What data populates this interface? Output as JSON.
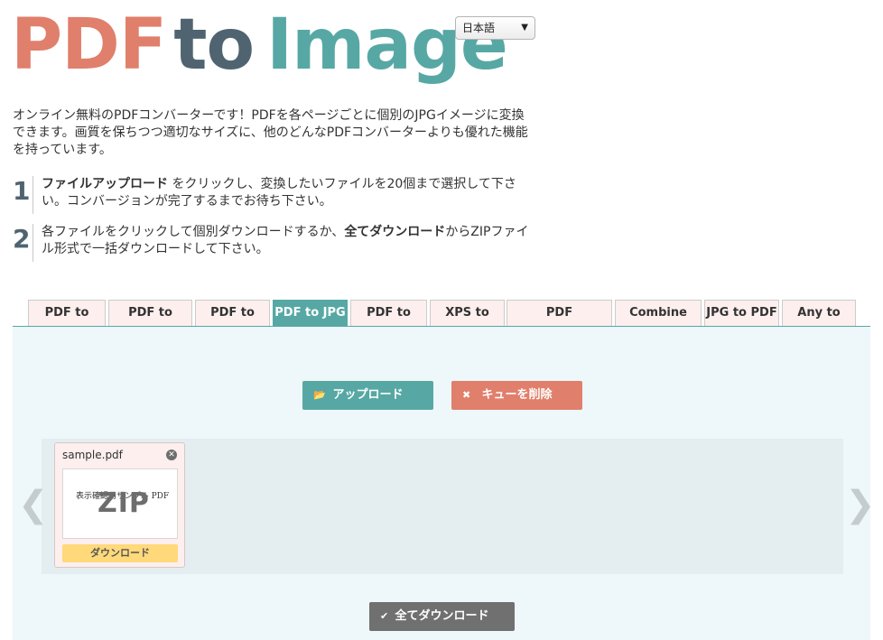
{
  "logo": {
    "part1": "PDF",
    "part2": "to",
    "part3": "Image"
  },
  "language": {
    "selected": "日本語"
  },
  "intro": "オンライン無料のPDFコンバーターです！PDFを各ページごとに個別のJPGイメージに変換できます。画質を保ちつつ適切なサイズに、他のどんなPDFコンバーターよりも優れた機能を持っています。",
  "steps": [
    {
      "num": "1",
      "bold": "ファイルアップロード",
      "text": " をクリックし、変換したいファイルを20個まで選択して下さい。コンバージョンが完了するまでお待ち下さい。"
    },
    {
      "num": "2",
      "pre": "各ファイルをクリックして個別ダウンロードするか、",
      "bold": "全てダウンロード",
      "text": "からZIPファイル形式で一括ダウンロードして下さい。"
    }
  ],
  "tabs": [
    "PDF to DOC",
    "PDF to DOCX",
    "PDF to Text",
    "PDF to JPG",
    "PDF to PNG",
    "XPS to PDF",
    "PDF Compressor",
    "Combine PDF",
    "JPG to PDF",
    "Any to PDF"
  ],
  "active_tab": "PDF to JPG",
  "buttons": {
    "upload": "アップロード",
    "clear": "キューを削除",
    "download_all": "全てダウンロード"
  },
  "file": {
    "name": "sample.pdf",
    "thumb_small": "表示確認用サンプル PDF",
    "thumb_big": "ZIP",
    "download": "ダウンロード"
  },
  "nav": {
    "prev": "❮",
    "next": "❯"
  },
  "icons": {
    "upload": "folder-open-icon",
    "clear": "close-icon",
    "download_all": "check-icon",
    "file_close": "close-circle-icon"
  },
  "colors": {
    "accent": "#57a8a4",
    "coral": "#e07f6b",
    "dark": "#4f6470",
    "download": "#ffd97a"
  }
}
